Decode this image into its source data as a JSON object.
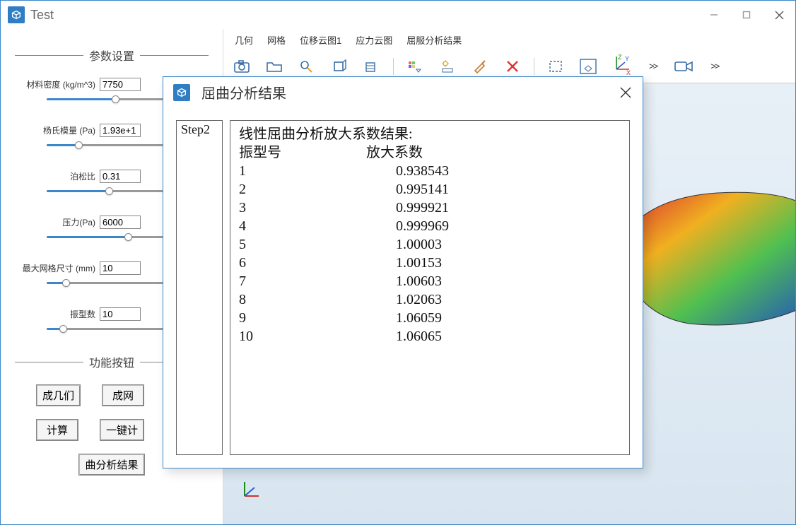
{
  "mainWindow": {
    "title": "Test"
  },
  "sidebar": {
    "paramSectionTitle": "参数设置",
    "funcSectionTitle": "功能按钮",
    "params": {
      "density": {
        "label": "材料密度 (kg/m^3)",
        "value": "7750"
      },
      "youngs": {
        "label": "杨氏模量 (Pa)",
        "value": "1.93e+1"
      },
      "poisson": {
        "label": "泊松比",
        "value": "0.31"
      },
      "pressure": {
        "label": "压力(Pa)",
        "value": "6000"
      },
      "meshSize": {
        "label": "最大网格尺寸 (mm)",
        "value": "10"
      },
      "modeCount": {
        "label": "振型数",
        "value": "10"
      }
    },
    "buttons": {
      "genGeom": "成几们",
      "genMesh": "成网",
      "compute": "计算",
      "oneKey": "一键计",
      "buckling": "曲分析结果"
    }
  },
  "tabs": [
    "几何",
    "网格",
    "位移云图1",
    "应力云图",
    "屈服分析结果"
  ],
  "dialog": {
    "title": "屈曲分析结果",
    "step": "Step2",
    "resultsTitle": "线性屈曲分析放大系数结果:",
    "colHeaders": {
      "mode": "振型号",
      "factor": "放大系数"
    },
    "rows": [
      {
        "mode": "1",
        "factor": "0.938543"
      },
      {
        "mode": "2",
        "factor": "0.995141"
      },
      {
        "mode": "3",
        "factor": "0.999921"
      },
      {
        "mode": "4",
        "factor": "0.999969"
      },
      {
        "mode": "5",
        "factor": "1.00003"
      },
      {
        "mode": "6",
        "factor": "1.00153"
      },
      {
        "mode": "7",
        "factor": "1.00603"
      },
      {
        "mode": "8",
        "factor": "1.02063"
      },
      {
        "mode": "9",
        "factor": "1.06059"
      },
      {
        "mode": "10",
        "factor": "1.06065"
      }
    ]
  }
}
